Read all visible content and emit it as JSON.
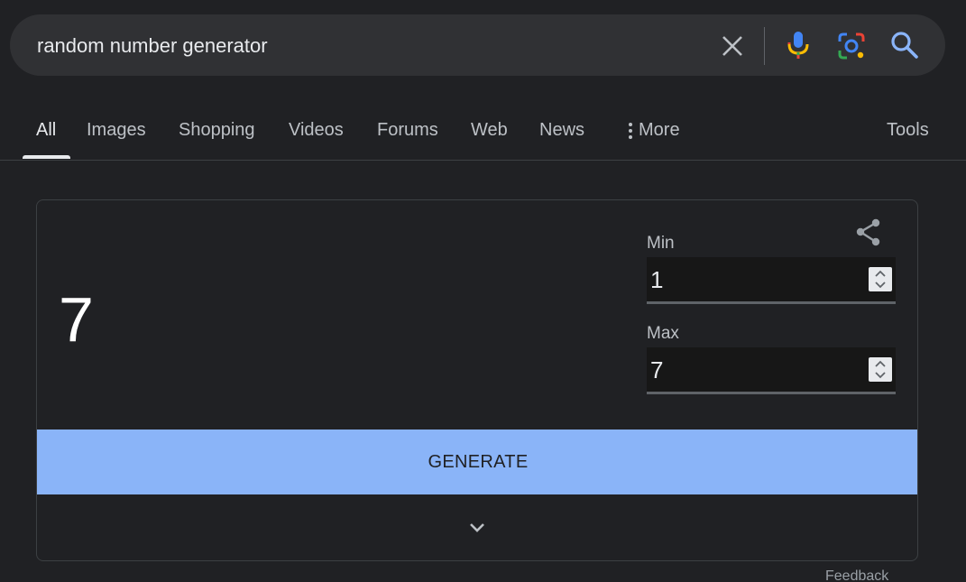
{
  "search": {
    "query": "random number generator"
  },
  "tabs": [
    {
      "label": "All",
      "active": true
    },
    {
      "label": "Images"
    },
    {
      "label": "Shopping"
    },
    {
      "label": "Videos"
    },
    {
      "label": "Forums"
    },
    {
      "label": "Web"
    },
    {
      "label": "News"
    },
    {
      "label": "More"
    },
    {
      "label": "Tools"
    }
  ],
  "generator": {
    "result": "7",
    "min_label": "Min",
    "min_value": "1",
    "max_label": "Max",
    "max_value": "7",
    "generate_label": "GENERATE"
  },
  "feedback_label": "Feedback",
  "colors": {
    "background": "#202124",
    "search_bar": "#303134",
    "accent": "#8ab4f8",
    "field_bg": "#171717"
  },
  "icons": [
    "close-icon",
    "mic-icon",
    "lens-icon",
    "search-icon",
    "more-dots-icon",
    "share-icon",
    "chevron-down-icon",
    "spinner-arrows-icon"
  ]
}
